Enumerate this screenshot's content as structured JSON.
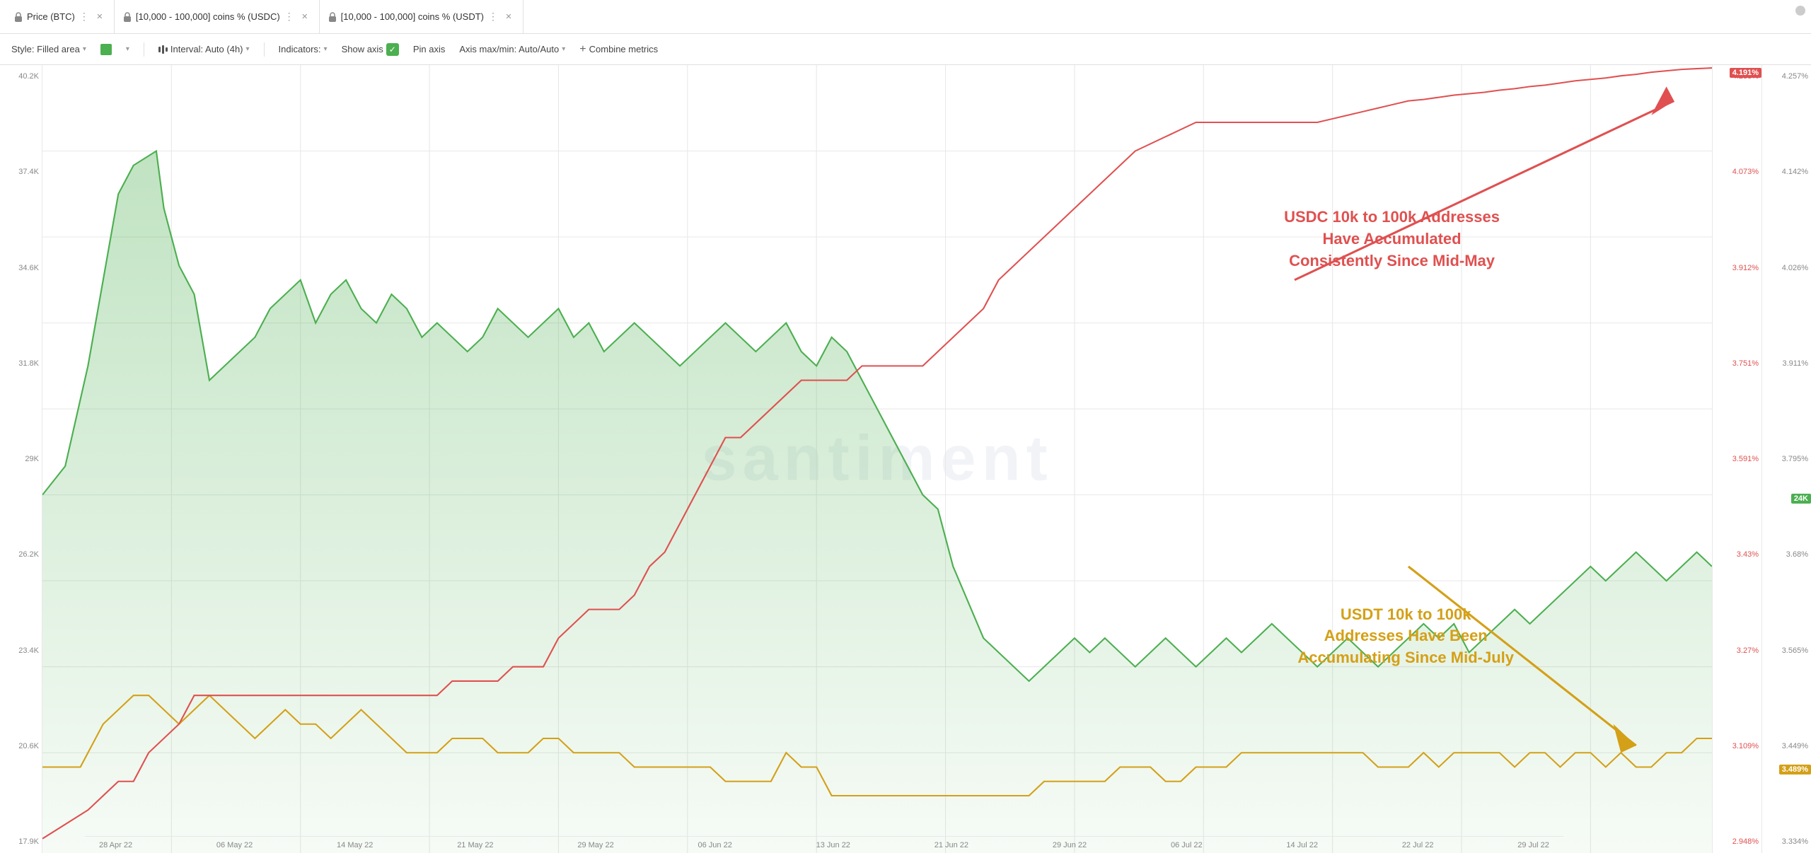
{
  "tabs": [
    {
      "id": "price-btc",
      "label": "Price (BTC)",
      "locked": true,
      "closable": true
    },
    {
      "id": "usdc-coins",
      "label": "[10,000 - 100,000] coins % (USDC)",
      "locked": true,
      "closable": true
    },
    {
      "id": "usdt-coins",
      "label": "[10,000 - 100,000] coins % (USDT)",
      "locked": true,
      "closable": true
    }
  ],
  "toolbar": {
    "style_label": "Style: Filled area",
    "interval_label": "Interval: Auto (4h)",
    "indicators_label": "Indicators:",
    "show_axis_label": "Show axis",
    "pin_axis_label": "Pin axis",
    "axis_maxmin_label": "Axis max/min: Auto/Auto",
    "combine_metrics_label": "Combine metrics"
  },
  "y_axis_left": {
    "values": [
      "40.2K",
      "37.4K",
      "34.6K",
      "31.8K",
      "29K",
      "26.2K",
      "23.4K",
      "20.6K",
      "17.9K"
    ]
  },
  "y_axis_right1": {
    "values": [
      "4.233%",
      "4.073%",
      "3.912%",
      "3.751%",
      "3.591%",
      "3.43%",
      "3.27%",
      "3.109%",
      "2.948%"
    ],
    "badge": "4.191%"
  },
  "y_axis_right2": {
    "values": [
      "4.257%",
      "4.142%",
      "4.026%",
      "3.911%",
      "3.795%",
      "3.68%",
      "3.565%",
      "3.449%",
      "3.334%"
    ],
    "badge": "3.489%"
  },
  "x_axis": {
    "labels": [
      "28 Apr 22",
      "06 May 22",
      "14 May 22",
      "21 May 22",
      "29 May 22",
      "06 Jun 22",
      "13 Jun 22",
      "21 Jun 22",
      "29 Jun 22",
      "06 Jul 22",
      "14 Jul 22",
      "22 Jul 22",
      "29 Jul 22"
    ]
  },
  "annotations": {
    "red": {
      "line1": "USDC 10k to 100k Addresses",
      "line2": "Have Accumulated",
      "line3": "Consistently Since Mid-May"
    },
    "gold": {
      "line1": "USDT 10k to 100k",
      "line2": "Addresses Have Been",
      "line3": "Accumulating Since Mid-July"
    }
  },
  "badges": {
    "red_badge": "4.191%",
    "green_badge": "24K",
    "gold_badge": "3.489%"
  },
  "watermark": "santiment"
}
